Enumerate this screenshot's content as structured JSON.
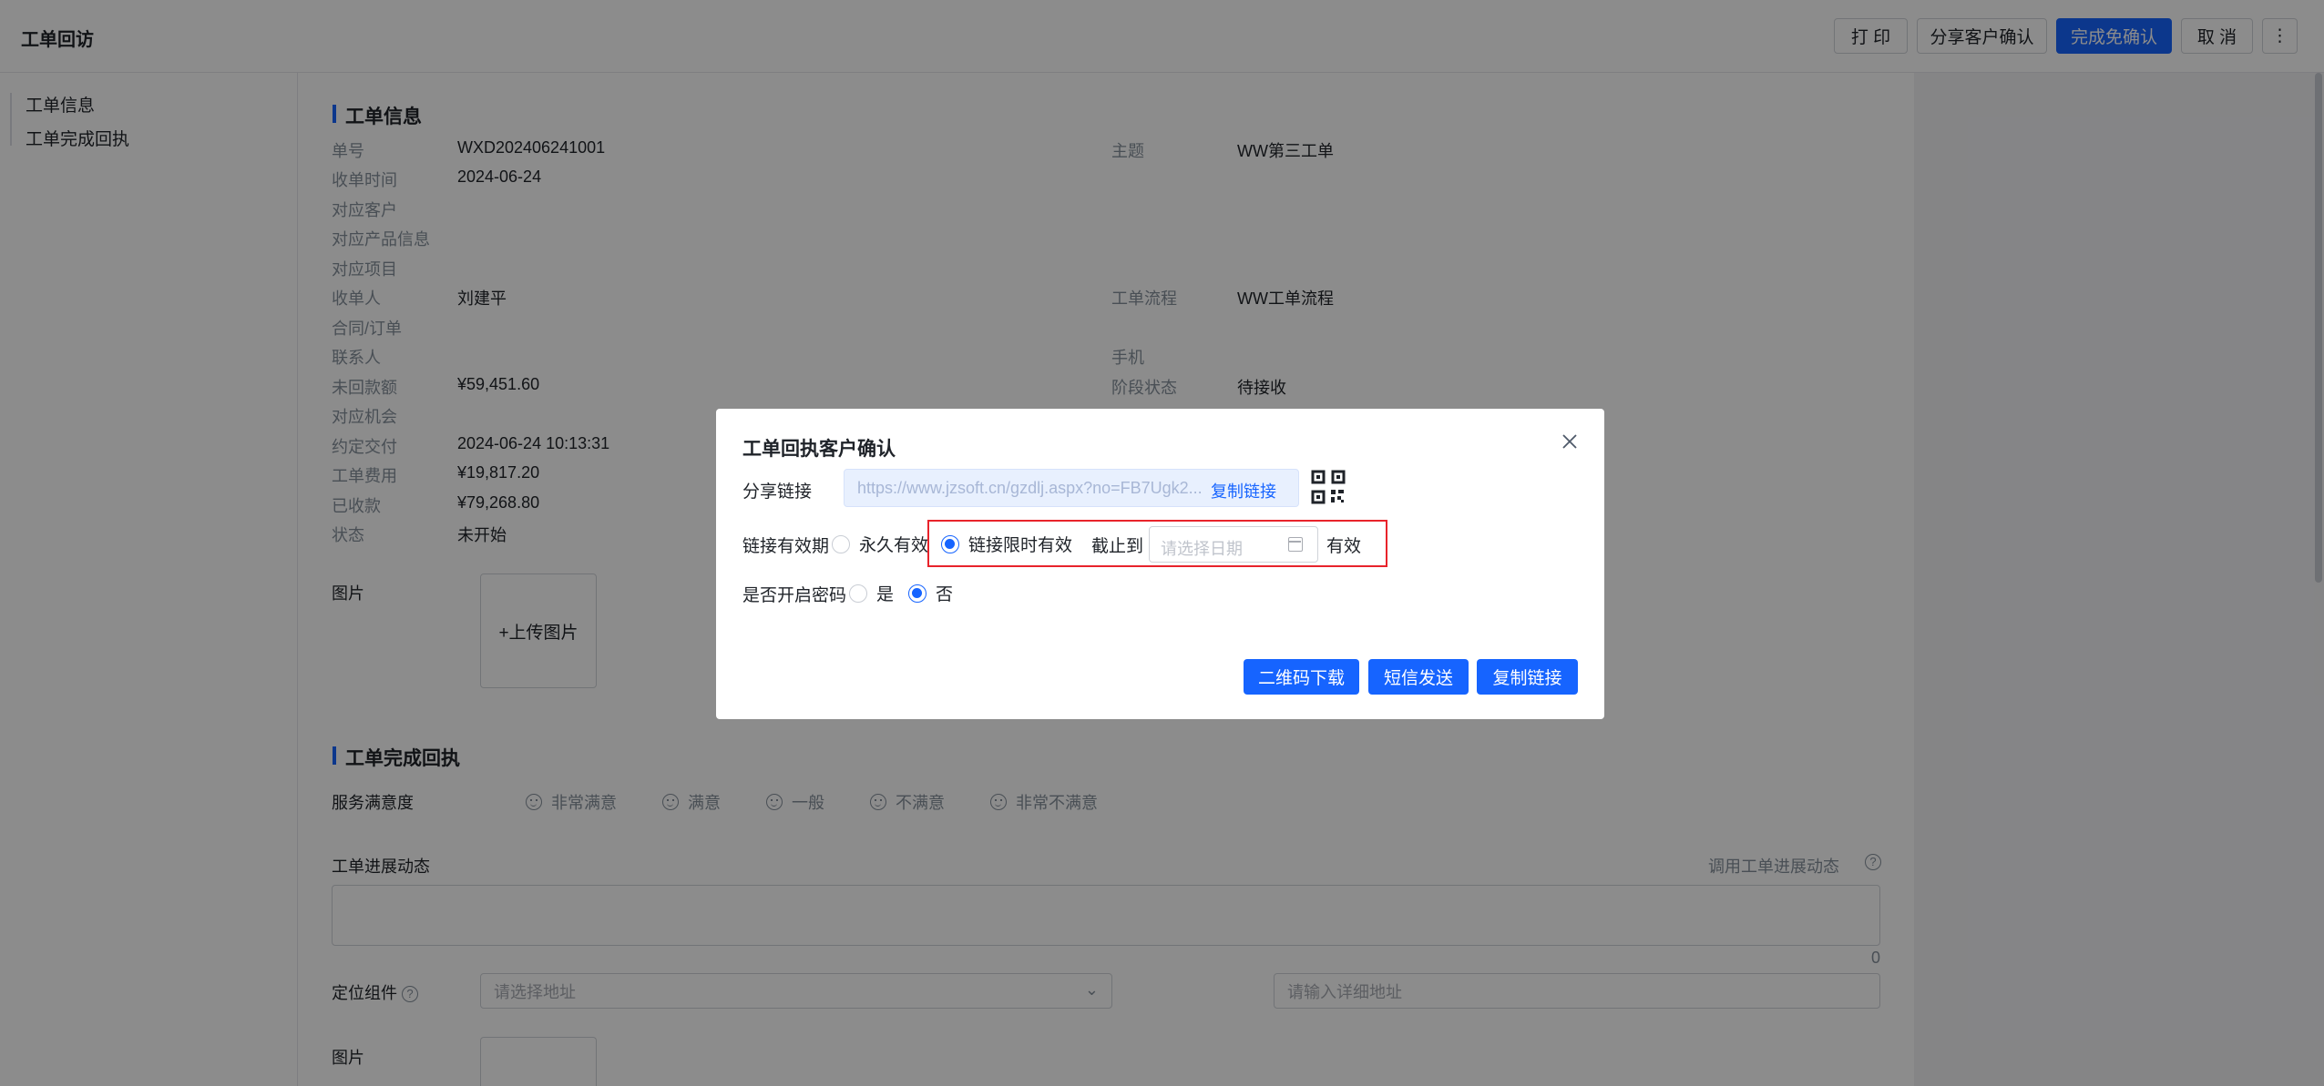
{
  "header": {
    "title": "工单回访",
    "buttons": {
      "print": "打 印",
      "share": "分享客户确认",
      "complete": "完成免确认",
      "cancel": "取 消",
      "more": "⋮"
    }
  },
  "sidenav": {
    "items": [
      "工单信息",
      "工单完成回执"
    ]
  },
  "work_order": {
    "section_title": "工单信息",
    "left_fields": [
      {
        "label": "单号",
        "value": "WXD202406241001"
      },
      {
        "label": "收单时间",
        "value": "2024-06-24"
      },
      {
        "label": "对应客户",
        "value": ""
      },
      {
        "label": "对应产品信息",
        "value": ""
      },
      {
        "label": "对应项目",
        "value": ""
      },
      {
        "label": "收单人",
        "value": "刘建平"
      },
      {
        "label": "合同/订单",
        "value": ""
      },
      {
        "label": "联系人",
        "value": ""
      },
      {
        "label": "未回款额",
        "value": "¥59,451.60"
      },
      {
        "label": "对应机会",
        "value": ""
      },
      {
        "label": "约定交付",
        "value": "2024-06-24 10:13:31"
      },
      {
        "label": "工单费用",
        "value": "¥19,817.20"
      },
      {
        "label": "已收款",
        "value": "¥79,268.80"
      },
      {
        "label": "状态",
        "value": "未开始"
      }
    ],
    "right_fields": [
      {
        "label": "主题",
        "value": "WW第三工单"
      },
      {
        "label": "工单流程",
        "value": "WW工单流程"
      },
      {
        "label": "手机",
        "value": ""
      },
      {
        "label": "阶段状态",
        "value": "待接收"
      }
    ],
    "image_label": "图片",
    "upload_label": "+上传图片"
  },
  "completion": {
    "section_title": "工单完成回执",
    "satisfaction_label": "服务满意度",
    "satisfaction_options": [
      "非常满意",
      "满意",
      "一般",
      "不满意",
      "非常不满意"
    ],
    "progress_label": "工单进展动态",
    "progress_link": "调用工单进展动态",
    "char_count": "0",
    "location_label": "定位组件",
    "address_placeholder": "请选择地址",
    "detail_placeholder": "请输入详细地址",
    "image_label": "图片"
  },
  "modal": {
    "title": "工单回执客户确认",
    "share_label": "分享链接",
    "share_url": "https://www.jzsoft.cn/gzdlj.aspx?no=FB7Ugk2...",
    "copy_inline": "复制链接",
    "validity_label": "链接有效期",
    "opt_forever": "永久有效",
    "opt_limited": "链接限时有效",
    "deadline_label": "截止到",
    "date_placeholder": "请选择日期",
    "valid_suffix": "有效",
    "password_label": "是否开启密码",
    "opt_yes": "是",
    "opt_no": "否",
    "buttons": {
      "qr_download": "二维码下载",
      "sms_send": "短信发送",
      "copy_link": "复制链接"
    },
    "colors": {
      "accent": "#1664ff",
      "highlight_box": "#e8232b"
    }
  }
}
